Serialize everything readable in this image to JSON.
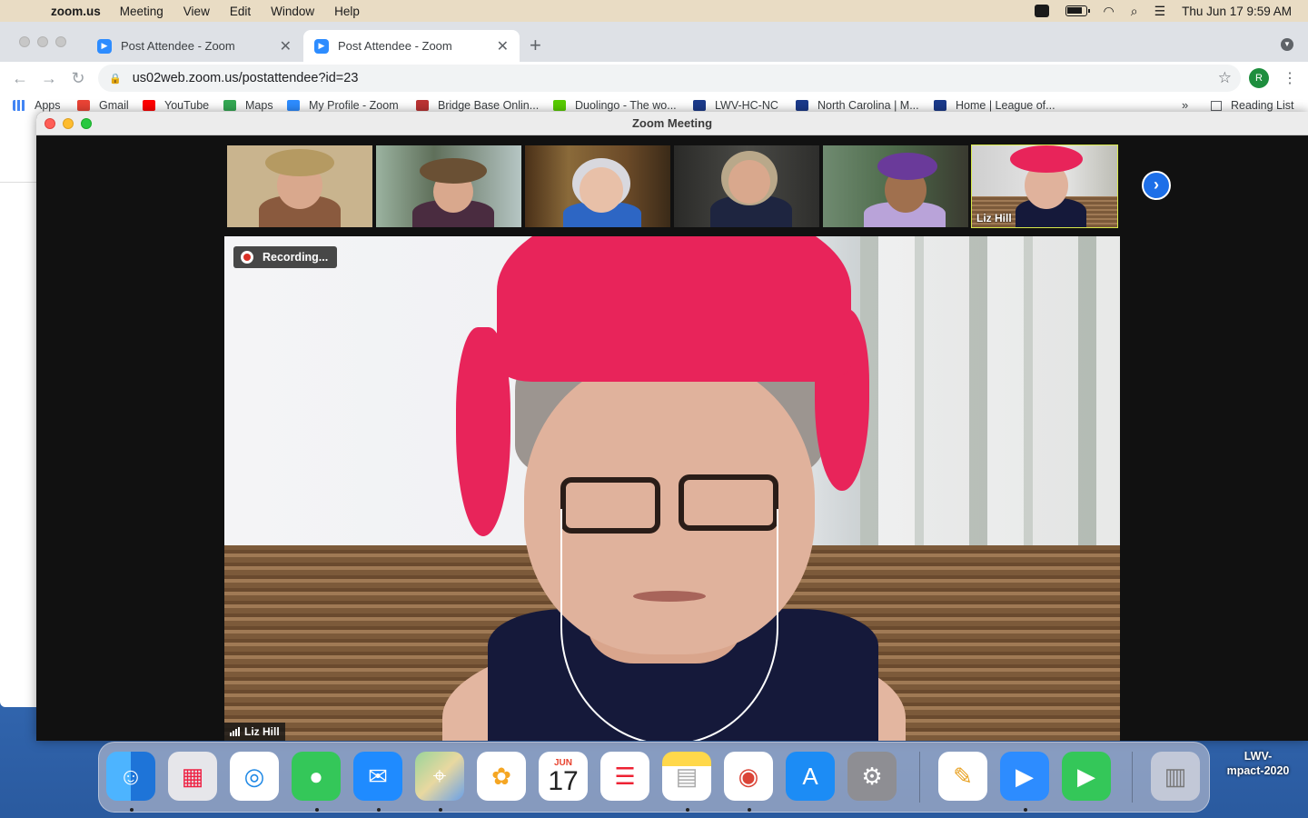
{
  "menubar": {
    "app_name": "zoom.us",
    "items": [
      "Meeting",
      "View",
      "Edit",
      "Window",
      "Help"
    ],
    "datetime": "Thu Jun 17  9:59 AM"
  },
  "browser": {
    "tabs": [
      {
        "title": "Post Attendee - Zoom",
        "active": false
      },
      {
        "title": "Post Attendee - Zoom",
        "active": true
      }
    ],
    "new_tab": "+",
    "url": "us02web.zoom.us/postattendee?id=23",
    "profile_initial": "R",
    "bookmarks": [
      {
        "label": "Apps",
        "color": "#4285f4"
      },
      {
        "label": "Gmail",
        "color": "#ea4335"
      },
      {
        "label": "YouTube",
        "color": "#ff0000"
      },
      {
        "label": "Maps",
        "color": "#34a853"
      },
      {
        "label": "My Profile - Zoom",
        "color": "#2d8cff"
      },
      {
        "label": "Bridge Base Onlin...",
        "color": "#b33"
      },
      {
        "label": "Duolingo - The wo...",
        "color": "#58cc02"
      },
      {
        "label": "LWV-HC-NC",
        "color": "#1b3a8a"
      },
      {
        "label": "North Carolina | M...",
        "color": "#1b3a8a"
      },
      {
        "label": "Home | League of...",
        "color": "#1b3a8a"
      }
    ],
    "more": "»",
    "reading_list": "Reading List"
  },
  "zoom": {
    "window_title": "Zoom Meeting",
    "recording_label": "Recording...",
    "active_speaker": "Liz Hill",
    "thumbnails": [
      {
        "name": "",
        "bg": "#c9b48e",
        "hat": "#b59a62",
        "body": "#8a5a3e"
      },
      {
        "name": "",
        "bg": "#5f6f5a",
        "hat": "#6a5034",
        "body": "#4a2c40"
      },
      {
        "name": "",
        "bg": "#6b4a28",
        "hat": "",
        "body": "#2d66c4"
      },
      {
        "name": "",
        "bg": "#3a3a38",
        "hat": "",
        "body": "#1e2540"
      },
      {
        "name": "",
        "bg": "#4d6a4a",
        "hat": "#6a3a9a",
        "body": "#b9a3d9"
      },
      {
        "name": "Liz Hill",
        "bg": "#d8d6d2",
        "hat": "#e8245a",
        "body": "#15193a"
      }
    ],
    "next_page": "›"
  },
  "dock": {
    "apps": [
      {
        "name": "finder",
        "color": "#3aa0f0",
        "glyph": "☺",
        "running": true
      },
      {
        "name": "launchpad",
        "color": "#e6e6ea",
        "glyph": "▦",
        "running": false
      },
      {
        "name": "safari",
        "color": "#1e88e5",
        "glyph": "◎",
        "running": false
      },
      {
        "name": "messages",
        "color": "#34c759",
        "glyph": "💬",
        "running": true
      },
      {
        "name": "mail",
        "color": "#1f8bff",
        "glyph": "✉",
        "running": true
      },
      {
        "name": "maps",
        "color": "#6fc26b",
        "glyph": "⌖",
        "running": true
      },
      {
        "name": "photos",
        "color": "#ffffff",
        "glyph": "✿",
        "running": false
      },
      {
        "name": "calendar",
        "color": "#ffffff",
        "glyph": "",
        "running": false
      },
      {
        "name": "reminders",
        "color": "#ffffff",
        "glyph": "☰",
        "running": false
      },
      {
        "name": "notes",
        "color": "#ffd84a",
        "glyph": "▤",
        "running": true
      },
      {
        "name": "chrome",
        "color": "#ffffff",
        "glyph": "◉",
        "running": true
      },
      {
        "name": "app-store",
        "color": "#1c8cf5",
        "glyph": "A",
        "running": false
      },
      {
        "name": "system-preferences",
        "color": "#8e8e93",
        "glyph": "⚙",
        "running": false
      },
      {
        "name": "pages",
        "color": "#ffffff",
        "glyph": "✎",
        "running": false
      },
      {
        "name": "zoom",
        "color": "#2d8cff",
        "glyph": "▶",
        "running": true
      },
      {
        "name": "facetime",
        "color": "#34c759",
        "glyph": "▶",
        "running": false
      },
      {
        "name": "trash",
        "color": "#d8d8dc",
        "glyph": "🗑",
        "running": false
      }
    ],
    "calendar_month": "JUN",
    "calendar_day": "17",
    "desktop_file": "LWV-\nmpact-2020"
  }
}
